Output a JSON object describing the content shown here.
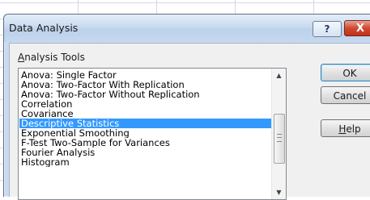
{
  "dialog": {
    "title": "Data Analysis",
    "help_glyph": "?",
    "close_glyph": "X"
  },
  "analysis_tools": {
    "label_underlined": "A",
    "label_rest": "nalysis Tools",
    "items": [
      {
        "label": "Anova: Single Factor",
        "selected": false
      },
      {
        "label": "Anova: Two-Factor With Replication",
        "selected": false
      },
      {
        "label": "Anova: Two-Factor Without Replication",
        "selected": false
      },
      {
        "label": "Correlation",
        "selected": false
      },
      {
        "label": "Covariance",
        "selected": false
      },
      {
        "label": "Descriptive Statistics",
        "selected": true
      },
      {
        "label": "Exponential Smoothing",
        "selected": false
      },
      {
        "label": "F-Test Two-Sample for Variances",
        "selected": false
      },
      {
        "label": "Fourier Analysis",
        "selected": false
      },
      {
        "label": "Histogram",
        "selected": false
      }
    ]
  },
  "buttons": {
    "ok": "OK",
    "cancel": "Cancel",
    "help_underlined": "H",
    "help_rest": "elp"
  },
  "icons": {
    "scroll_up": "chevron-up-icon",
    "scroll_down": "chevron-down-icon"
  }
}
